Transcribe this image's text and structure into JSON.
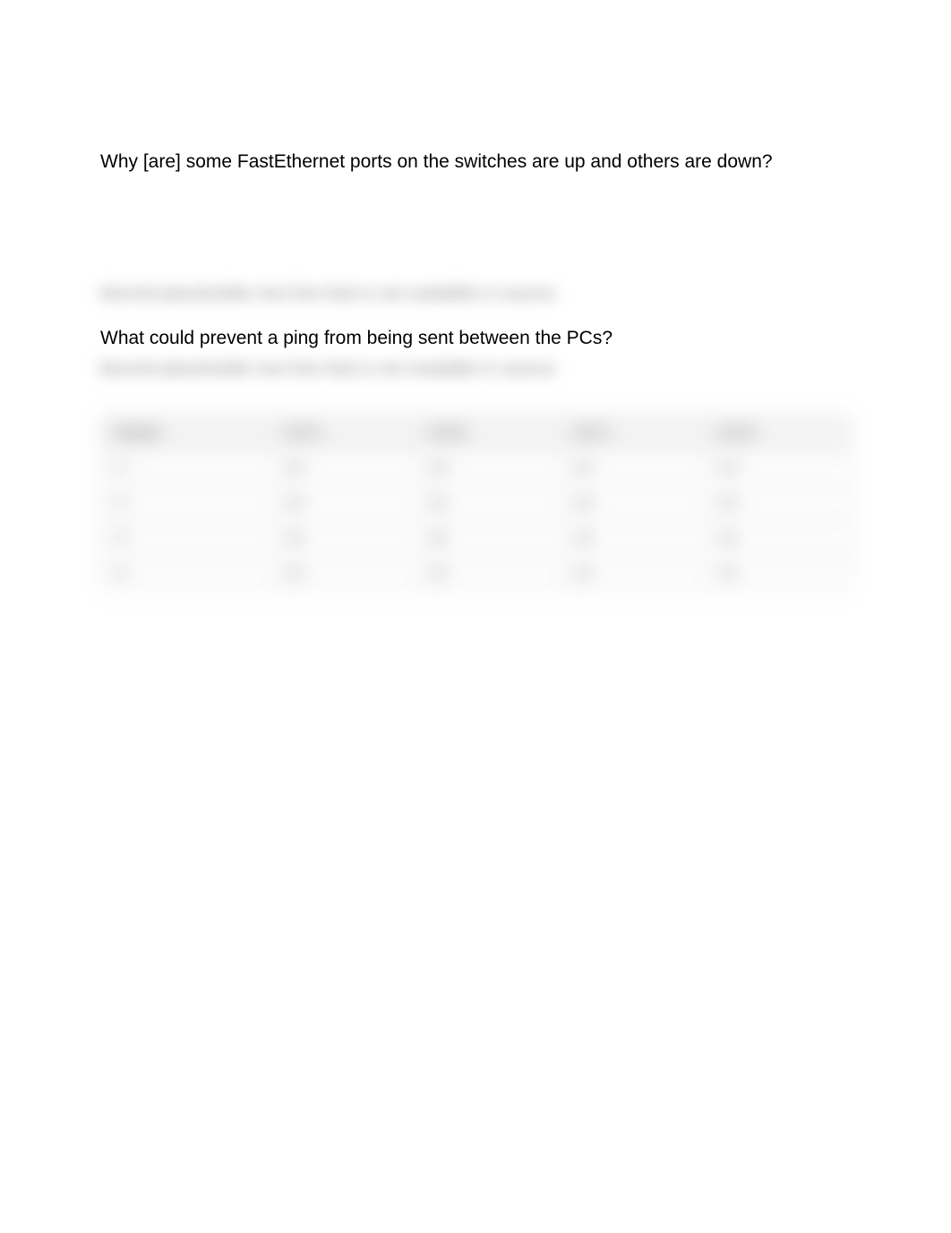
{
  "question1": "Why [are] some FastEthernet ports on the switches are up and others are down?",
  "question2": "What could prevent a ping from being sent between the PCs?",
  "blurred_above_q2": "blurred placeholder text line that is not readable in source",
  "blurred_below_q2": "blurred placeholder text line that is not readable in source",
  "table": {
    "headers": [
      "Header",
      "Col A",
      "Col B",
      "Col C",
      "Col D"
    ],
    "rows": [
      [
        "r1",
        "val",
        "val",
        "val",
        "val"
      ],
      [
        "r2",
        "val",
        "val",
        "val",
        "val"
      ],
      [
        "r3",
        "val",
        "val",
        "val",
        "val"
      ],
      [
        "r4",
        "val",
        "val",
        "val",
        "val"
      ]
    ]
  }
}
